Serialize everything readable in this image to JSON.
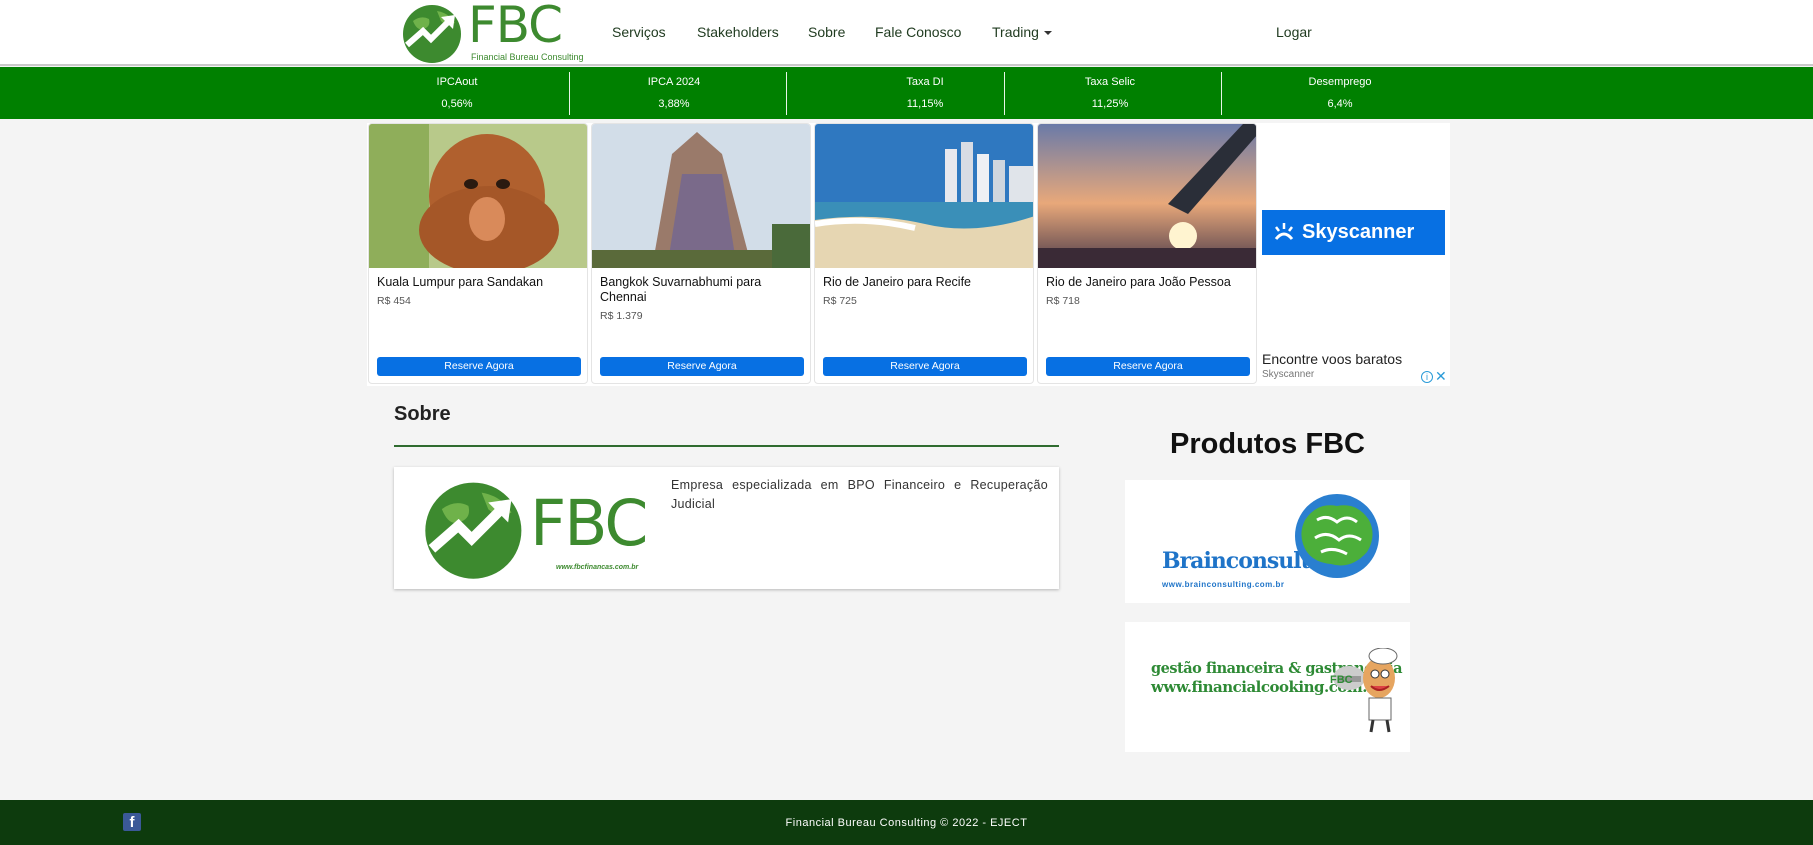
{
  "header": {
    "logo_text": "FBC",
    "logo_subtitle": "Financial Bureau Consulting",
    "nav": [
      "Serviços",
      "Stakeholders",
      "Sobre",
      "Fale Conosco",
      "Trading"
    ],
    "login": "Logar"
  },
  "ticker": [
    {
      "label": "IPCAout",
      "value": "0,56%"
    },
    {
      "label": "IPCA 2024",
      "value": "3,88%"
    },
    {
      "label": "Taxa DI",
      "value": "11,15%"
    },
    {
      "label": "Taxa Selic",
      "value": "11,25%"
    },
    {
      "label": "Desemprego",
      "value": "6,4%"
    }
  ],
  "ad": {
    "cards": [
      {
        "title": "Kuala Lumpur para Sandakan",
        "price": "R$ 454",
        "button": "Reserve Agora"
      },
      {
        "title": "Bangkok Suvarnabhumi para Chennai",
        "price": "R$ 1.379",
        "button": "Reserve Agora"
      },
      {
        "title": "Rio de Janeiro para Recife",
        "price": "R$ 725",
        "button": "Reserve Agora"
      },
      {
        "title": "Rio de Janeiro para João Pessoa",
        "price": "R$ 718",
        "button": "Reserve Agora"
      }
    ],
    "brand": "Skyscanner",
    "tagline": "Encontre voos baratos",
    "source": "Skyscanner",
    "info_glyph": "i",
    "close_glyph": "✕"
  },
  "sobre": {
    "title": "Sobre",
    "logo_text": "FBC",
    "logo_url": "www.fbcfinancas.com.br",
    "text": "Empresa especializada em BPO Financeiro e Recuperação Judicial"
  },
  "produtos": {
    "title": "Produtos FBC",
    "brainconsulting": {
      "name": "Brainconsulting",
      "url": "www.brainconsulting.com.br"
    },
    "financialcooking": {
      "line1": "gestão financeira & gastronomia",
      "line2": "www.financialcooking.com.br",
      "badge": "FBC"
    }
  },
  "footer": {
    "facebook_glyph": "f",
    "copyright": "Financial Bureau Consulting © 2022 - EJECT"
  }
}
